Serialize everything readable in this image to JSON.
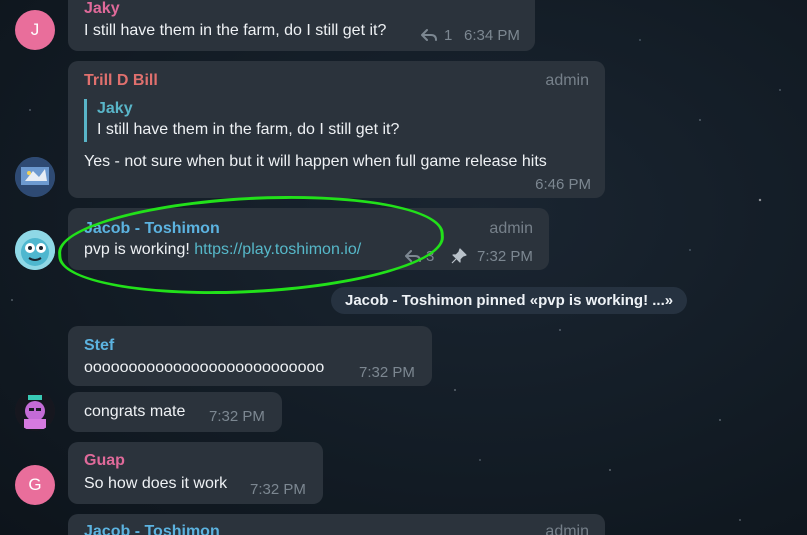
{
  "messages": [
    {
      "id": "jaky",
      "sender": "Jaky",
      "avatar_initial": "J",
      "text": "I still have them in the farm, do I still get it?",
      "reply_count": "1",
      "time": "6:34 PM"
    },
    {
      "id": "trill",
      "sender": "Trill D Bill",
      "role": "admin",
      "quote_sender": "Jaky",
      "quote_text": "I still have them in the farm, do I still get it?",
      "text": "Yes - not sure when but it will happen when full game release hits",
      "time": "6:46 PM"
    },
    {
      "id": "jacob",
      "sender": "Jacob - Toshimon",
      "role": "admin",
      "text": "pvp is working!",
      "link": "https://play.toshimon.io/",
      "reply_count": "3",
      "time": "7:32 PM"
    },
    {
      "id": "stef",
      "sender": "Stef",
      "text": "ooooooooooooooooooooooooooo",
      "time": "7:32 PM"
    },
    {
      "id": "congrats",
      "text": "congrats mate",
      "time": "7:32 PM"
    },
    {
      "id": "guap",
      "sender": "Guap",
      "avatar_initial": "G",
      "text": "So how does it work",
      "time": "7:32 PM"
    },
    {
      "id": "jacob2",
      "sender": "Jacob - Toshimon",
      "role": "admin"
    }
  ],
  "pinned_notice": "Jacob - Toshimon pinned «pvp is working! ...»",
  "colors": {
    "bubble": "#2b333c",
    "jaky_name": "#e06a9a",
    "trill_name": "#e0706e",
    "jacob_name": "#5cb3e0",
    "stef_name": "#5cb3e0",
    "guap_name": "#e06a9a",
    "quote_name": "#59b5c8",
    "link": "#56b8c9",
    "highlight": "#22e11a"
  },
  "icons": {
    "reply": "reply-arrow-icon",
    "pin": "pin-icon"
  }
}
